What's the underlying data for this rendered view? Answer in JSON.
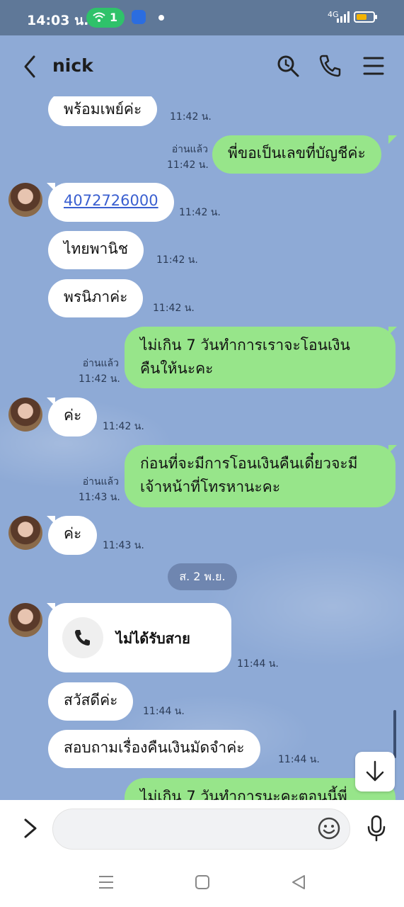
{
  "status_bar": {
    "time": "14:03 น.",
    "hotspot_count": "1",
    "network": "4G"
  },
  "header": {
    "title": "nick"
  },
  "messages": [
    {
      "text": "พร้อมเพย์ค่ะ",
      "time": "11:42 น."
    },
    {
      "text": "พี่ขอเป็นเลขที่บัญชีค่ะ",
      "time": "11:42 น.",
      "read": "อ่านแล้ว"
    },
    {
      "text": "4072726000",
      "time": "11:42 น."
    },
    {
      "text": "ไทยพานิช",
      "time": "11:42 น."
    },
    {
      "text": "พรนิภาค่ะ",
      "time": "11:42 น."
    },
    {
      "line1": "ไม่เกิน 7 วันทำการเราจะโอนเงิน",
      "line2": "คืนให้นะคะ",
      "time": "11:42 น.",
      "read": "อ่านแล้ว"
    },
    {
      "text": "ค่ะ",
      "time": "11:42 น."
    },
    {
      "line1": "ก่อนที่จะมีการโอนเงินคืนเดี๋ยวจะมี",
      "line2": "เจ้าหน้าที่โทรหานะคะ",
      "time": "11:43 น.",
      "read": "อ่านแล้ว"
    },
    {
      "text": "ค่ะ",
      "time": "11:43 น."
    },
    {
      "text": "ไม่ได้รับสาย",
      "time": "11:44 น."
    },
    {
      "text": "สวัสดีค่ะ",
      "time": "11:44 น."
    },
    {
      "text": "สอบถามเรื่องคืนเงินมัดจำค่ะ",
      "time": "11:44 น."
    },
    {
      "text": "ไม่เกิน 7 วันทำการนะคะตอนนี้พี่"
    }
  ],
  "date_separator": "ส. 2 พ.ย.",
  "colors": {
    "chat_background": "#8eaad6",
    "my_bubble": "#97e58a",
    "their_bubble": "#ffffff",
    "status_bar": "#5f7898"
  }
}
